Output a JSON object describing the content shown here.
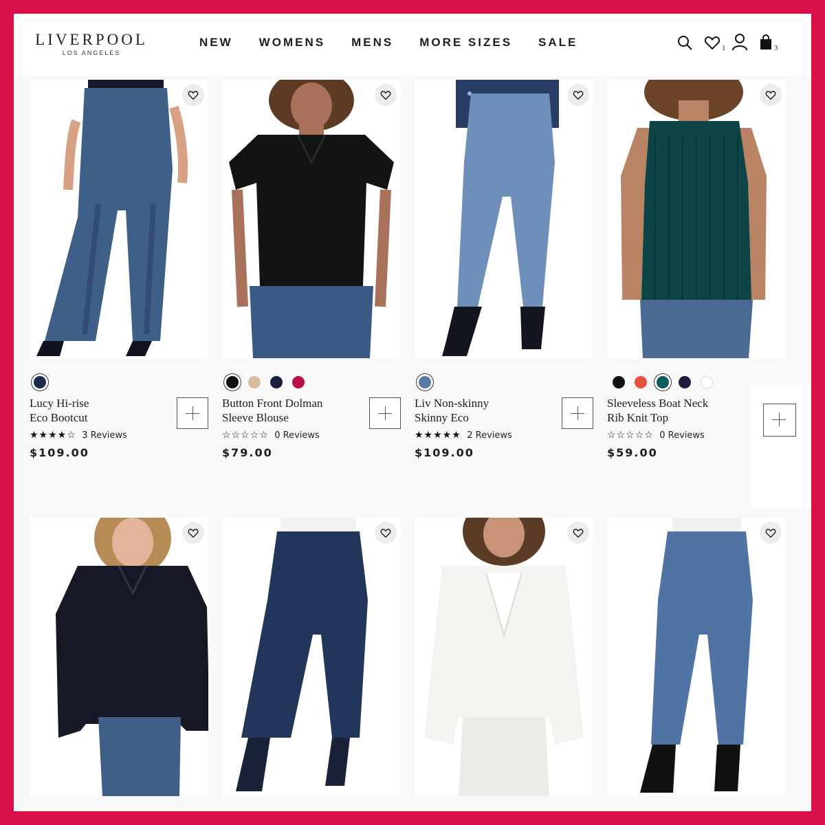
{
  "brand": {
    "name": "LIVERPOOL",
    "tagline": "LOS ANGELES"
  },
  "nav": {
    "items": [
      {
        "label": "NEW"
      },
      {
        "label": "WOMENS"
      },
      {
        "label": "MENS"
      },
      {
        "label": "MORE SIZES"
      },
      {
        "label": "SALE"
      }
    ]
  },
  "header_icons": {
    "search": "search-icon",
    "wishlist": "heart-icon",
    "wishlist_count": "1",
    "account": "user-icon",
    "bag": "shopping-bag-icon",
    "bag_count": "3"
  },
  "colors": {
    "frame": "#d8104a",
    "text": "#1d1d1d"
  },
  "products": [
    {
      "name_line1": "Lucy Hi-rise",
      "name_line2": "Eco Bootcut",
      "stars": "★★★★☆",
      "reviews": "3 Reviews",
      "price": "$109.00",
      "rating": 4,
      "swatches": [
        "#1b2b48"
      ],
      "selected": 0
    },
    {
      "name_line1": "Button Front Dolman",
      "name_line2": "Sleeve Blouse",
      "stars": "☆☆☆☆☆",
      "reviews": "0 Reviews",
      "price": "$79.00",
      "rating": 0,
      "swatches": [
        "#111111",
        "#d8bb9e",
        "#1a1f3d",
        "#b8104c"
      ],
      "selected": 0
    },
    {
      "name_line1": "Liv Non-skinny",
      "name_line2": "Skinny Eco",
      "stars": "★★★★★",
      "reviews": "2 Reviews",
      "price": "$109.00",
      "rating": 5,
      "swatches": [
        "#5a79a6"
      ],
      "selected": 0
    },
    {
      "name_line1": "Sleeveless Boat Neck",
      "name_line2": "Rib Knit Top",
      "stars": "☆☆☆☆☆",
      "reviews": "0 Reviews",
      "price": "$59.00",
      "rating": 0,
      "swatches": [
        "#111111",
        "#e5503f",
        "#0f5a5b",
        "#1a1f3d",
        "#ffffff"
      ],
      "selected": 2
    },
    {
      "description": "black long sleeve button-up blouse"
    },
    {
      "description": "dark wash cropped flare jeans"
    },
    {
      "description": "white blazer with white pants"
    },
    {
      "description": "medium wash straight jeans"
    }
  ]
}
